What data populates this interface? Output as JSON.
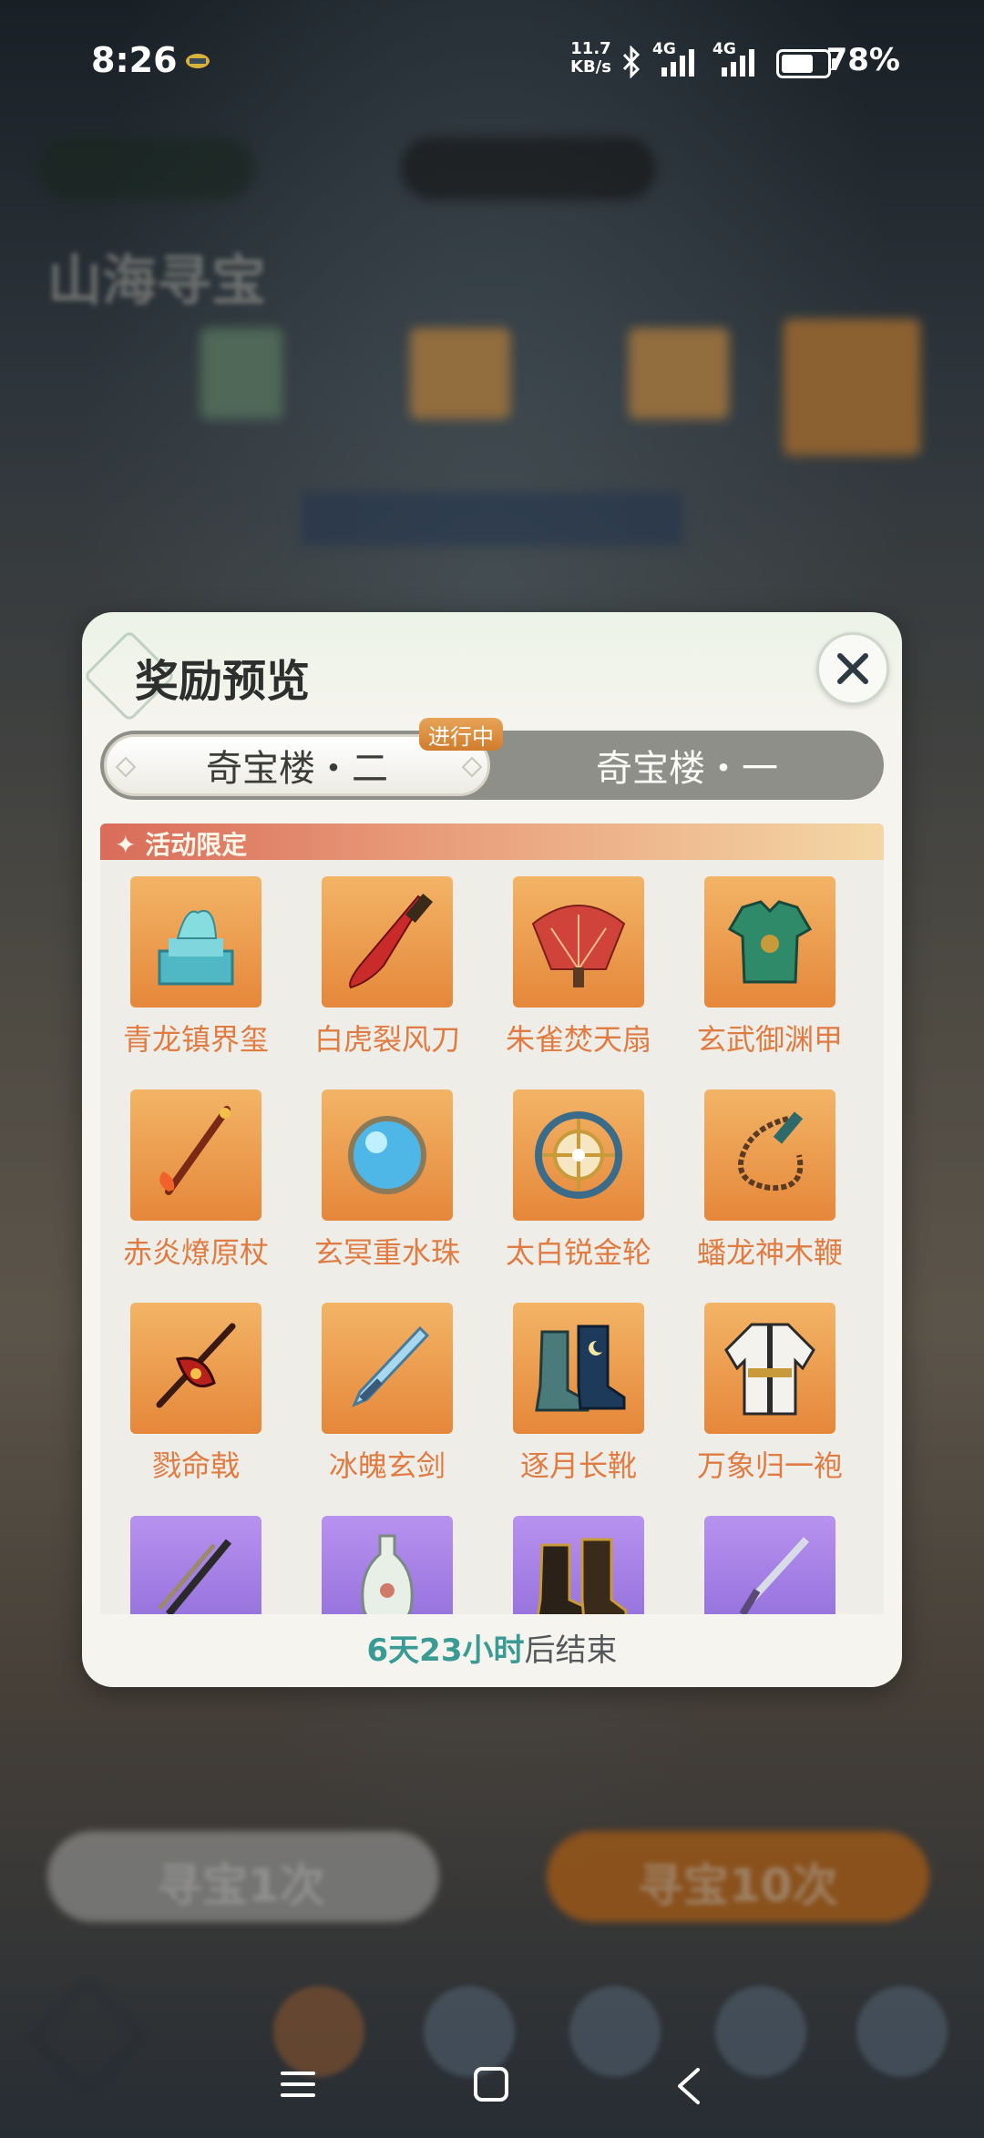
{
  "status_bar": {
    "time": "8:26",
    "speed_value": "11.7",
    "speed_unit": "KB/s",
    "net1": "4G",
    "net2": "4G",
    "battery": "78%"
  },
  "background": {
    "page_title": "山海寻宝",
    "btn_single": "寻宝1次",
    "btn_ten": "寻宝10次"
  },
  "modal": {
    "title": "奖励预览",
    "tab_active": "奇宝楼・二",
    "tab_inactive": "奇宝楼・一",
    "badge": "进行中",
    "section_title": "活动限定",
    "footer_highlight": "6天23小时",
    "footer_suffix": "后结束",
    "items": [
      {
        "name": "青龙镇界玺",
        "icon": "jade-seal-icon",
        "rarity": "orange"
      },
      {
        "name": "白虎裂风刀",
        "icon": "saber-icon",
        "rarity": "orange"
      },
      {
        "name": "朱雀焚天扇",
        "icon": "fan-icon",
        "rarity": "orange"
      },
      {
        "name": "玄武御渊甲",
        "icon": "armor-icon",
        "rarity": "orange"
      },
      {
        "name": "赤炎燎原杖",
        "icon": "staff-icon",
        "rarity": "orange"
      },
      {
        "name": "玄冥重水珠",
        "icon": "orb-icon",
        "rarity": "orange"
      },
      {
        "name": "太白锐金轮",
        "icon": "wheel-icon",
        "rarity": "orange"
      },
      {
        "name": "蟠龙神木鞭",
        "icon": "whip-icon",
        "rarity": "orange"
      },
      {
        "name": "戮命戟",
        "icon": "halberd-icon",
        "rarity": "orange"
      },
      {
        "name": "冰魄玄剑",
        "icon": "ice-sword-icon",
        "rarity": "orange"
      },
      {
        "name": "逐月长靴",
        "icon": "boots-icon",
        "rarity": "orange"
      },
      {
        "name": "万象归一袍",
        "icon": "robe-icon",
        "rarity": "orange"
      },
      {
        "name": "",
        "icon": "dual-blades-icon",
        "rarity": "purple"
      },
      {
        "name": "",
        "icon": "vase-icon",
        "rarity": "purple"
      },
      {
        "name": "",
        "icon": "dark-boots-icon",
        "rarity": "purple"
      },
      {
        "name": "",
        "icon": "dagger-icon",
        "rarity": "purple"
      }
    ]
  },
  "colors": {
    "orange_frame": "#e5873a",
    "purple_frame": "#8d6ad8",
    "item_name": "#e07b42",
    "countdown": "#3a9a94"
  }
}
